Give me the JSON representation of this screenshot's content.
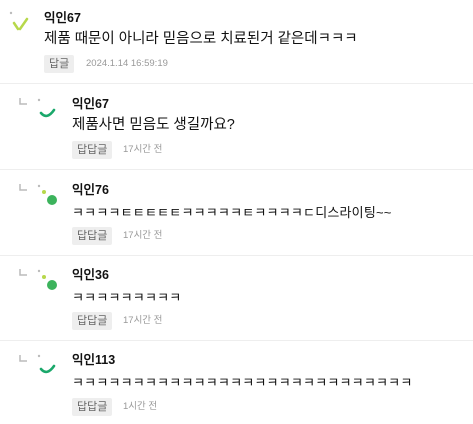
{
  "comments": [
    {
      "nickname": "익인67",
      "text": "제품 때문이 아니라 믿음으로 치료된거 같은데ㅋㅋㅋ",
      "reply_label": "답글",
      "timestamp": "2024.1.14 16:59:19",
      "avatar_color": "#9acd32"
    },
    {
      "nickname": "익인67",
      "text": "제품사면 믿음도 생길까요?",
      "reply_label": "답답글",
      "timestamp": "17시간 전",
      "avatar_color": "#1aa86b"
    },
    {
      "nickname": "익인76",
      "text": "ㅋㅋㅋㅋㅌㅌㅌㅌㅌㅋㅋㅋㅋㅋㅌㅋㅋㅋㅋㄷ디스라이팅~~",
      "reply_label": "답답글",
      "timestamp": "17시간 전",
      "avatar_color": "#3cb35c"
    },
    {
      "nickname": "익인36",
      "text": "ㅋㅋㅋㅋㅋㅋㅋㅋㅋ",
      "reply_label": "답답글",
      "timestamp": "17시간 전",
      "avatar_color": "#3cb35c"
    },
    {
      "nickname": "익인113",
      "text": "ㅋㅋㅋㅋㅋㅋㅋㅋㅋㅋㅋㅋㅋㅋㅋㅋㅋㅋㅋㅋㅋㅋㅋㅋㅋㅋㅋㅋ",
      "reply_label": "답답글",
      "timestamp": "1시간 전",
      "avatar_color": "#1aa86b"
    }
  ]
}
